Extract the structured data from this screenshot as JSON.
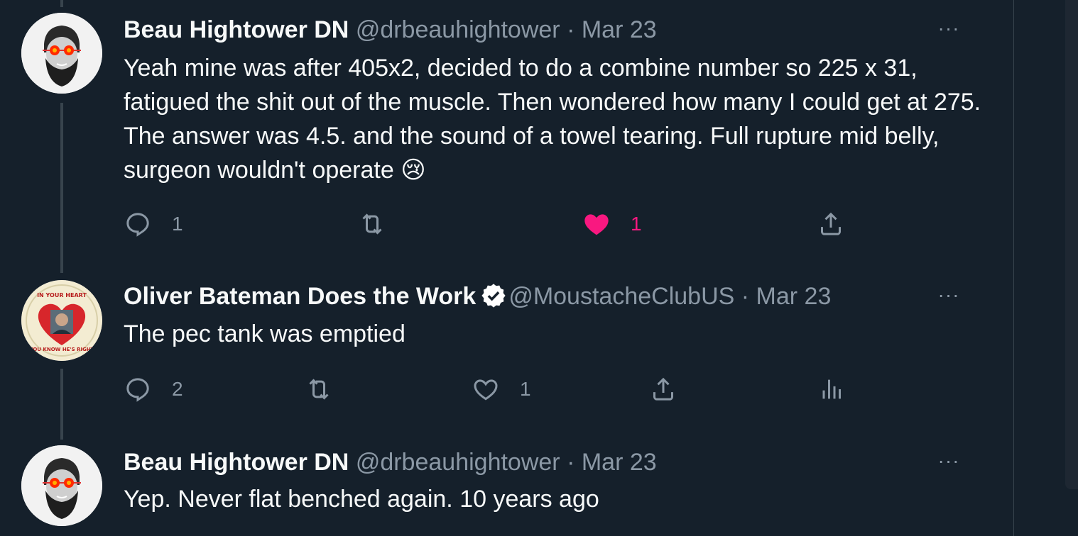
{
  "tweets": [
    {
      "name": "Beau Hightower DN",
      "handle": "@drbeauhightower",
      "separator": "·",
      "date": "Mar 23",
      "more": "···",
      "text": "Yeah mine was after 405x2, decided to do a combine number so 225 x 31, fatigued the shit out of the muscle. Then wondered how many I could get at 275. The answer was 4.5. and the sound of a towel tearing. Full rupture mid belly, surgeon wouldn't operate 😢",
      "reply_count": "1",
      "retweet_count": "",
      "like_count": "1",
      "liked": true,
      "icons": [
        "reply-icon",
        "retweet-icon",
        "heart-filled-icon",
        "share-icon"
      ]
    },
    {
      "name": "Oliver Bateman Does the Work",
      "verified": true,
      "handle": "@MoustacheClubUS",
      "separator": "·",
      "date": "Mar 23",
      "more": "···",
      "text": "The pec tank was emptied",
      "reply_count": "2",
      "retweet_count": "",
      "like_count": "1",
      "liked": false,
      "avatar_text": {
        "top": "IN YOUR HEART",
        "bottom": "YOU KNOW HE'S RIGHT"
      },
      "icons": [
        "reply-icon",
        "retweet-icon",
        "heart-outline-icon",
        "share-icon",
        "analytics-icon"
      ]
    },
    {
      "name": "Beau Hightower DN",
      "handle": "@drbeauhightower",
      "separator": "·",
      "date": "Mar 23",
      "more": "···",
      "text": "Yep. Never flat benched again. 10 years ago"
    }
  ],
  "colors": {
    "background": "#15202b",
    "secondary_text": "#8b98a5",
    "like": "#f91880",
    "thread_line": "#38444d"
  }
}
